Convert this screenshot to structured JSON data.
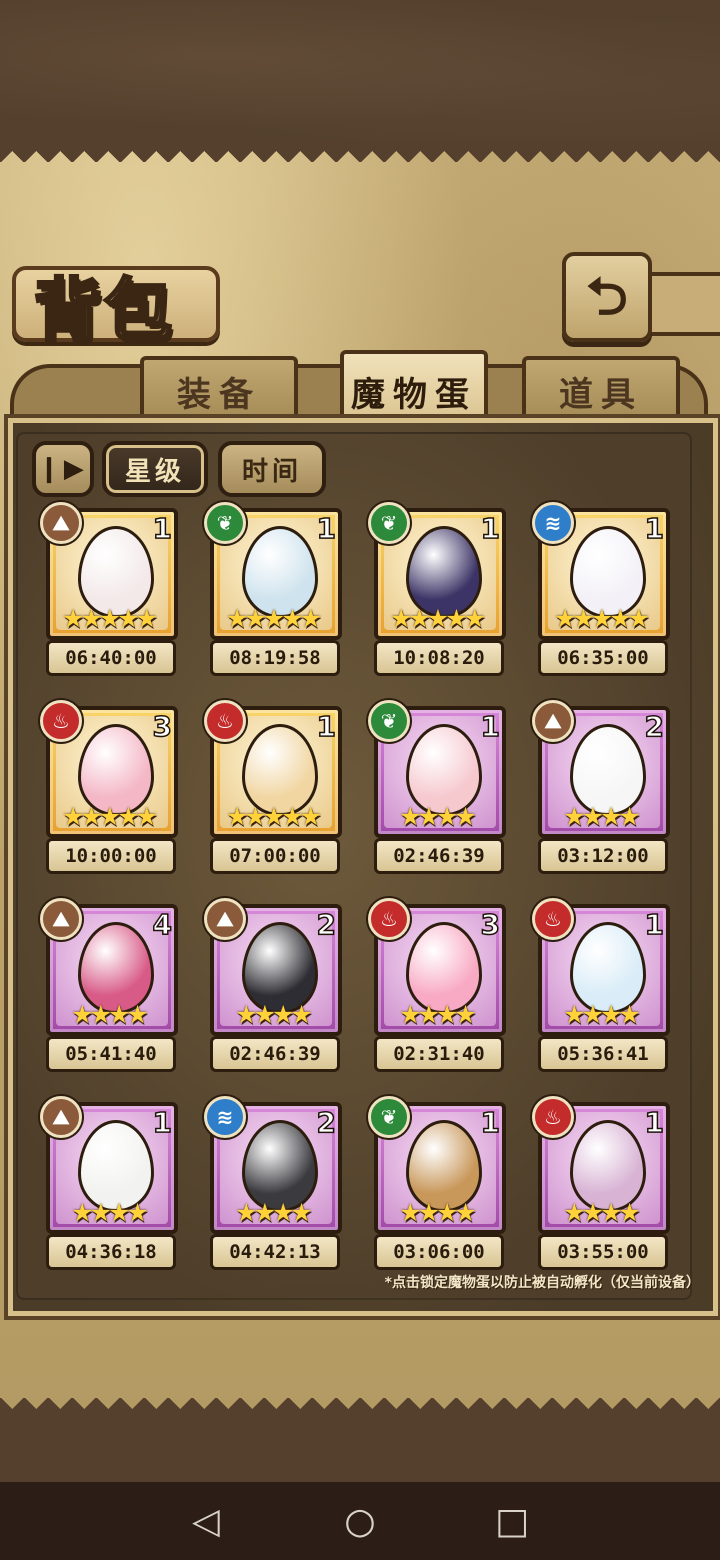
{
  "header": {
    "title": "背包",
    "back_icon": "back-arrow-icon"
  },
  "tabs": [
    {
      "label": "装备",
      "active": false
    },
    {
      "label": "魔物蛋",
      "active": true
    },
    {
      "label": "道具",
      "active": false
    }
  ],
  "filters": {
    "sort_icon": "pause-sort-icon",
    "star_label": "星级",
    "time_label": "时间",
    "active": "星级"
  },
  "eggs": [
    {
      "element": "earth",
      "rarity": "gold",
      "count": "1",
      "stars": 5,
      "timer": "06:40:00",
      "color": "#f3e9e9"
    },
    {
      "element": "plant",
      "rarity": "gold",
      "count": "1",
      "stars": 5,
      "timer": "08:19:58",
      "color": "#cfe3ee"
    },
    {
      "element": "plant",
      "rarity": "gold",
      "count": "1",
      "stars": 5,
      "timer": "10:08:20",
      "color": "#3c3466"
    },
    {
      "element": "water",
      "rarity": "gold",
      "count": "1",
      "stars": 5,
      "timer": "06:35:00",
      "color": "#f3f1f7"
    },
    {
      "element": "fire",
      "rarity": "gold",
      "count": "3",
      "stars": 5,
      "timer": "10:00:00",
      "color": "#f4b7c6"
    },
    {
      "element": "fire",
      "rarity": "gold",
      "count": "1",
      "stars": 5,
      "timer": "07:00:00",
      "color": "#f1d6a2"
    },
    {
      "element": "plant",
      "rarity": "purple",
      "count": "1",
      "stars": 4,
      "timer": "02:46:39",
      "color": "#f6c9cf"
    },
    {
      "element": "earth",
      "rarity": "purple",
      "count": "2",
      "stars": 4,
      "timer": "03:12:00",
      "color": "#f6f6f6"
    },
    {
      "element": "earth",
      "rarity": "purple",
      "count": "4",
      "stars": 4,
      "timer": "05:41:40",
      "color": "#d85a86"
    },
    {
      "element": "earth",
      "rarity": "purple",
      "count": "2",
      "stars": 4,
      "timer": "02:46:39",
      "color": "#2d2d33"
    },
    {
      "element": "fire",
      "rarity": "purple",
      "count": "3",
      "stars": 4,
      "timer": "02:31:40",
      "color": "#f8a9c4"
    },
    {
      "element": "fire",
      "rarity": "purple",
      "count": "1",
      "stars": 4,
      "timer": "05:36:41",
      "color": "#d9ecf7"
    },
    {
      "element": "earth",
      "rarity": "purple",
      "count": "1",
      "stars": 4,
      "timer": "04:36:18",
      "color": "#f2f2f0"
    },
    {
      "element": "water",
      "rarity": "purple",
      "count": "2",
      "stars": 4,
      "timer": "04:42:13",
      "color": "#3a3a3f"
    },
    {
      "element": "plant",
      "rarity": "purple",
      "count": "1",
      "stars": 4,
      "timer": "03:06:00",
      "color": "#c8975a"
    },
    {
      "element": "fire",
      "rarity": "purple",
      "count": "1",
      "stars": 4,
      "timer": "03:55:00",
      "color": "#d8b3d4"
    }
  ],
  "footer_note": "*点击锁定魔物蛋以防止被自动孵化（仅当前设备）",
  "nav": {
    "back": "◁",
    "home": "○",
    "recent": "□"
  }
}
